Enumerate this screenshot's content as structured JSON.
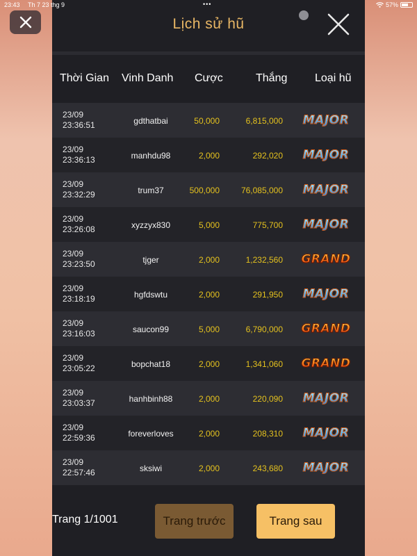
{
  "status_bar": {
    "time": "23:43",
    "date": "Th 7 23 thg 9",
    "battery": "57%",
    "battery_level": 0.57
  },
  "header": {
    "title": "Lịch sử hũ"
  },
  "columns": {
    "time": "Thời Gian",
    "name": "Vinh Danh",
    "bet": "Cược",
    "win": "Thắng",
    "type": "Loại hũ"
  },
  "rows": [
    {
      "date": "23/09",
      "time": "23:36:51",
      "name": "gdthatbai",
      "bet": "50,000",
      "win": "6,815,000",
      "type": "MAJOR"
    },
    {
      "date": "23/09",
      "time": "23:36:13",
      "name": "manhdu98",
      "bet": "2,000",
      "win": "292,020",
      "type": "MAJOR"
    },
    {
      "date": "23/09",
      "time": "23:32:29",
      "name": "trum37",
      "bet": "500,000",
      "win": "76,085,000",
      "type": "MAJOR"
    },
    {
      "date": "23/09",
      "time": "23:26:08",
      "name": "xyzzyx830",
      "bet": "5,000",
      "win": "775,700",
      "type": "MAJOR"
    },
    {
      "date": "23/09",
      "time": "23:23:50",
      "name": "tjger",
      "bet": "2,000",
      "win": "1,232,560",
      "type": "GRAND"
    },
    {
      "date": "23/09",
      "time": "23:18:19",
      "name": "hgfdswtu",
      "bet": "2,000",
      "win": "291,950",
      "type": "MAJOR"
    },
    {
      "date": "23/09",
      "time": "23:16:03",
      "name": "saucon99",
      "bet": "5,000",
      "win": "6,790,000",
      "type": "GRAND"
    },
    {
      "date": "23/09",
      "time": "23:05:22",
      "name": "bopchat18",
      "bet": "2,000",
      "win": "1,341,060",
      "type": "GRAND"
    },
    {
      "date": "23/09",
      "time": "23:03:37",
      "name": "hanhbinh88",
      "bet": "2,000",
      "win": "220,090",
      "type": "MAJOR"
    },
    {
      "date": "23/09",
      "time": "22:59:36",
      "name": "foreverloves",
      "bet": "2,000",
      "win": "208,310",
      "type": "MAJOR"
    },
    {
      "date": "23/09",
      "time": "22:57:46",
      "name": "sksiwi",
      "bet": "2,000",
      "win": "243,680",
      "type": "MAJOR"
    }
  ],
  "footer": {
    "page_label": "Trang 1/1001",
    "prev_label": "Trang trước",
    "next_label": "Trang sau"
  },
  "icons": {
    "outer_close": "close-icon",
    "panel_close": "close-icon",
    "wifi": "wifi-icon",
    "battery": "battery-icon"
  },
  "colors": {
    "accent": "#e9b765",
    "amount": "#e5c21e",
    "next_button": "#f6c065",
    "prev_button": "#7a5a33"
  }
}
